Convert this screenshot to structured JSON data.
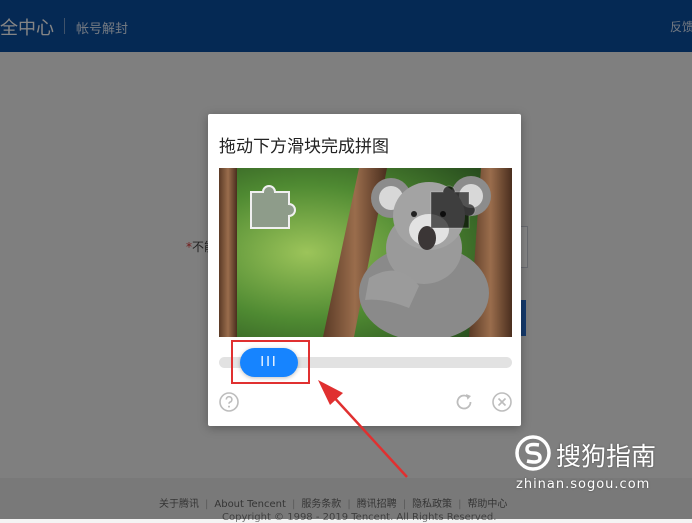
{
  "header": {
    "site_title": "全中心",
    "nav_link": "帐号解封",
    "feedback": "反馈"
  },
  "page": {
    "form_label_required": "*",
    "form_label_text": "不能"
  },
  "footer": {
    "links": [
      "关于腾讯",
      "About Tencent",
      "服务条款",
      "腾讯招聘",
      "隐私政策",
      "帮助中心"
    ],
    "separator": "|",
    "copyright": "Copyright © 1998 - 2019 Tencent. All Rights Reserved."
  },
  "captcha": {
    "title": "拖动下方滑块完成拼图",
    "slider_handle_glyph": "III",
    "slider_progress": 0.0,
    "icons": {
      "help": "help-icon",
      "refresh": "refresh-icon",
      "close": "close-icon"
    }
  },
  "annotation": {
    "highlight_color": "#e03030",
    "arrow_color": "#e03030"
  },
  "watermark": {
    "brand": "搜狗指南",
    "url": "zhinan.sogou.com"
  },
  "colors": {
    "header_bg": "#0b4fa2",
    "slider_handle": "#1684ff",
    "track": "#e2e2e2"
  }
}
